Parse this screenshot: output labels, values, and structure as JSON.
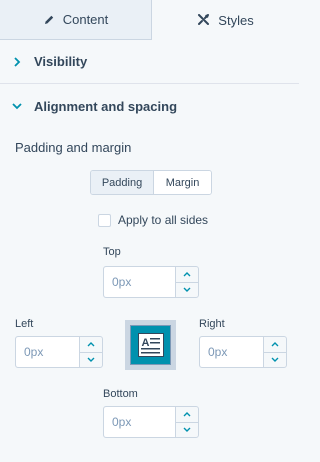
{
  "tabs": {
    "content_label": "Content",
    "styles_label": "Styles"
  },
  "sections": {
    "visibility_label": "Visibility",
    "alignment_label": "Alignment and spacing"
  },
  "padding_margin": {
    "title": "Padding and margin",
    "toggle": {
      "padding_label": "Padding",
      "margin_label": "Margin",
      "selected": "Padding"
    },
    "apply_all_label": "Apply to all sides",
    "apply_all_checked": false
  },
  "fields": {
    "top": {
      "label": "Top",
      "placeholder": "0px"
    },
    "left": {
      "label": "Left",
      "placeholder": "0px"
    },
    "right": {
      "label": "Right",
      "placeholder": "0px"
    },
    "bottom": {
      "label": "Bottom",
      "placeholder": "0px"
    }
  },
  "colors": {
    "accent": "#0091ae",
    "text": "#33475b",
    "border": "#cbd6e2",
    "background": "#f5f8fa"
  }
}
